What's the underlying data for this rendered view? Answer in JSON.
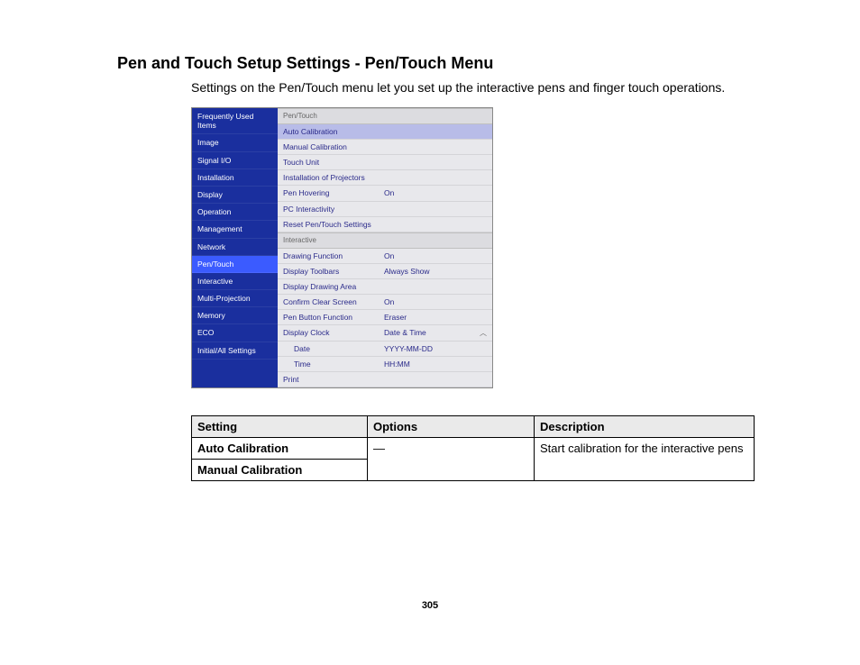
{
  "title": "Pen and Touch Setup Settings - Pen/Touch Menu",
  "intro": "Settings on the Pen/Touch menu let you set up the interactive pens and finger touch operations.",
  "sidebar": {
    "items": [
      "Frequently Used Items",
      "Image",
      "Signal I/O",
      "Installation",
      "Display",
      "Operation",
      "Management",
      "Network",
      "Pen/Touch",
      "Interactive",
      "Multi-Projection",
      "Memory",
      "ECO",
      "Initial/All Settings"
    ],
    "active_index": 8
  },
  "panel": {
    "section1": "Pen/Touch",
    "rows1": [
      {
        "lbl": "Auto Calibration",
        "val": "",
        "hl": true
      },
      {
        "lbl": "Manual Calibration",
        "val": ""
      },
      {
        "lbl": "Touch Unit",
        "val": ""
      },
      {
        "lbl": "Installation of Projectors",
        "val": ""
      },
      {
        "lbl": "Pen Hovering",
        "val": "On"
      },
      {
        "lbl": "PC Interactivity",
        "val": ""
      },
      {
        "lbl": "Reset Pen/Touch Settings",
        "val": ""
      }
    ],
    "section2": "Interactive",
    "rows2": [
      {
        "lbl": "Drawing Function",
        "val": "On"
      },
      {
        "lbl": "Display Toolbars",
        "val": "Always Show"
      },
      {
        "lbl": "Display Drawing Area",
        "val": ""
      },
      {
        "lbl": "Confirm Clear Screen",
        "val": "On"
      },
      {
        "lbl": "Pen Button Function",
        "val": "Eraser"
      },
      {
        "lbl": "Display Clock",
        "val": "Date & Time",
        "caret": true
      },
      {
        "lbl": "Date",
        "val": "YYYY-MM-DD",
        "indent": true
      },
      {
        "lbl": "Time",
        "val": "HH:MM",
        "indent": true
      },
      {
        "lbl": "Print",
        "val": ""
      }
    ]
  },
  "table": {
    "headers": [
      "Setting",
      "Options",
      "Description"
    ],
    "rows": [
      {
        "setting": "Auto Calibration",
        "options": "—",
        "description": "Start calibration for the interactive pens"
      },
      {
        "setting": "Manual Calibration",
        "options": "",
        "description": ""
      }
    ]
  },
  "page_number": "305"
}
